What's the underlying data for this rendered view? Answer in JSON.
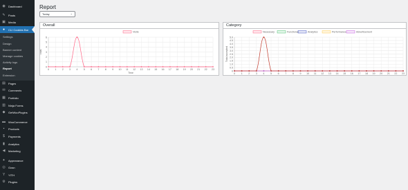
{
  "sidebar": {
    "items": [
      {
        "label": "Dashboard",
        "icon": "dashboard-icon",
        "glyph": "◉"
      },
      {
        "label": "Posts",
        "icon": "pin-icon",
        "glyph": "✎"
      },
      {
        "label": "Media",
        "icon": "media-icon",
        "glyph": "▣"
      },
      {
        "label": "CLI Cookies Bar",
        "icon": "cookie-icon",
        "glyph": "●"
      },
      {
        "label": "Pages",
        "icon": "page-icon",
        "glyph": "▤"
      },
      {
        "label": "Comments",
        "icon": "comment-icon",
        "glyph": "✉"
      },
      {
        "label": "Portfolio",
        "icon": "portfolio-icon",
        "glyph": "▦"
      },
      {
        "label": "Ninja Forms",
        "icon": "form-icon",
        "glyph": "▥"
      },
      {
        "label": "GetWooPlugins",
        "icon": "plugin-icon",
        "glyph": "◆"
      },
      {
        "label": "WooCommerce",
        "icon": "woo-icon",
        "glyph": "▬"
      },
      {
        "label": "Products",
        "icon": "products-icon",
        "glyph": "▪"
      },
      {
        "label": "Payments",
        "icon": "payments-icon",
        "glyph": "$"
      },
      {
        "label": "Analytics",
        "icon": "analytics-icon",
        "glyph": "▮"
      },
      {
        "label": "Marketing",
        "icon": "marketing-icon",
        "glyph": "◀"
      },
      {
        "label": "Appearance",
        "icon": "appearance-icon",
        "glyph": "✦"
      },
      {
        "label": "Gosn",
        "icon": "gosn-icon",
        "glyph": "◎"
      },
      {
        "label": "YITH",
        "icon": "yith-icon",
        "glyph": "Y"
      },
      {
        "label": "Plugins",
        "icon": "plugins-icon",
        "glyph": "⚙"
      }
    ],
    "submenu": [
      "Settings",
      "Design",
      "Banner content",
      "Manage cookies",
      "Activity logs",
      "Report",
      "Extension"
    ]
  },
  "page": {
    "title": "Report",
    "range": "Today"
  },
  "overall": {
    "title": "Overall",
    "legend": "Visits",
    "ylabel": "Total",
    "xlabel": "Time"
  },
  "category": {
    "title": "Category",
    "ylabel": "Total accepted",
    "legend": [
      "Necessary",
      "Functional",
      "Analytics",
      "Performance",
      "Advertisement"
    ]
  },
  "colors": {
    "accent": "#2271b1",
    "necessary": "#ff6384",
    "functional": "#4bc070",
    "analytics": "#4657c2",
    "performance": "#ffcd56",
    "advertisement": "#c45ce0"
  },
  "chart_data": [
    {
      "type": "line",
      "title": "Overall",
      "xlabel": "Time",
      "ylabel": "Total",
      "x": [
        "0",
        "1",
        "2",
        "3",
        "4",
        "5",
        "6",
        "7",
        "8",
        "9",
        "10",
        "11",
        "12",
        "13",
        "14",
        "15",
        "16",
        "17",
        "18",
        "19",
        "20",
        "21",
        "22",
        "23"
      ],
      "series": [
        {
          "name": "Visits",
          "values": [
            0,
            0,
            0,
            0,
            6,
            0,
            0,
            0,
            0,
            0,
            0,
            0,
            0,
            0,
            0,
            0,
            0,
            0,
            0,
            0,
            0,
            0,
            0,
            0
          ]
        }
      ],
      "ylim": [
        0,
        6
      ],
      "yticks": [
        "0",
        "1",
        "2",
        "3",
        "4",
        "5",
        "6"
      ]
    },
    {
      "type": "line",
      "title": "Category",
      "xlabel": "",
      "ylabel": "Total accepted",
      "x": [
        "0",
        "1",
        "2",
        "3",
        "4",
        "5",
        "6",
        "7",
        "8",
        "9",
        "10",
        "11",
        "12",
        "13",
        "14",
        "15",
        "16",
        "17",
        "18",
        "19",
        "20",
        "21",
        "22",
        "23"
      ],
      "series": [
        {
          "name": "Necessary",
          "values": [
            0,
            0,
            0,
            0,
            5,
            0,
            0,
            0,
            0,
            0,
            0,
            0,
            0,
            0,
            0,
            0,
            0,
            0,
            0,
            0,
            0,
            0,
            0,
            0
          ]
        },
        {
          "name": "Functional",
          "values": [
            0,
            0,
            0,
            0,
            0,
            0,
            0,
            0,
            0,
            0,
            0,
            0,
            0,
            0,
            0,
            0,
            0,
            0,
            0,
            0,
            0,
            0,
            0,
            0
          ]
        },
        {
          "name": "Analytics",
          "values": [
            0,
            0,
            0,
            0,
            0,
            0,
            0,
            0,
            0,
            0,
            0,
            0,
            0,
            0,
            0,
            0,
            0,
            0,
            0,
            0,
            0,
            0,
            0,
            0
          ]
        },
        {
          "name": "Performance",
          "values": [
            0,
            0,
            0,
            0,
            0,
            0,
            0,
            0,
            0,
            0,
            0,
            0,
            0,
            0,
            0,
            0,
            0,
            0,
            0,
            0,
            0,
            0,
            0,
            0
          ]
        },
        {
          "name": "Advertisement",
          "values": [
            0,
            0,
            0,
            0,
            0,
            0,
            0,
            0,
            0,
            0,
            0,
            0,
            0,
            0,
            0,
            0,
            0,
            0,
            0,
            0,
            0,
            0,
            0,
            0
          ]
        }
      ],
      "ylim": [
        0,
        5
      ],
      "yticks": [
        "0",
        "0.5",
        "1.0",
        "1.5",
        "2.0",
        "2.5",
        "3.0",
        "3.5",
        "4.0",
        "4.5",
        "5.0"
      ]
    }
  ]
}
